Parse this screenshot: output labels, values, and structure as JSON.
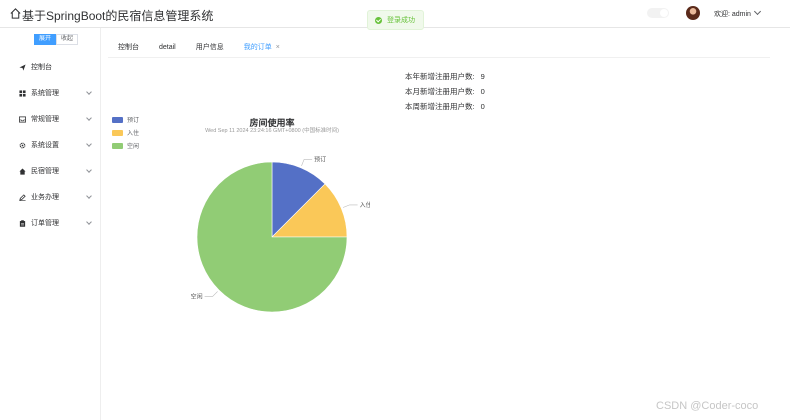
{
  "header": {
    "title": "基于SpringBoot的民宿信息管理系统",
    "toast": "登录成功",
    "welcome": "欢迎: admin"
  },
  "sidebar": {
    "expand_label": "展开",
    "collapse_label": "收起",
    "items": [
      {
        "label": "控制台",
        "icon": "send-icon",
        "has_children": false
      },
      {
        "label": "系统管理",
        "icon": "grid-icon",
        "has_children": true
      },
      {
        "label": "常规管理",
        "icon": "inbox-icon",
        "has_children": true
      },
      {
        "label": "系统设置",
        "icon": "gear-icon",
        "has_children": true
      },
      {
        "label": "民宿管理",
        "icon": "home-icon",
        "has_children": true
      },
      {
        "label": "业务办理",
        "icon": "edit-icon",
        "has_children": true
      },
      {
        "label": "订单管理",
        "icon": "clipboard-icon",
        "has_children": true
      }
    ]
  },
  "tabs": [
    {
      "label": "控制台",
      "active": false
    },
    {
      "label": "detail",
      "active": false
    },
    {
      "label": "用户信息",
      "active": false
    },
    {
      "label": "我的订单",
      "active": true,
      "closable": true
    }
  ],
  "stats": [
    {
      "label": "本年新增注册用户数:",
      "value": "9"
    },
    {
      "label": "本月新增注册用户数:",
      "value": "0"
    },
    {
      "label": "本周新增注册用户数:",
      "value": "0"
    }
  ],
  "chart_data": {
    "type": "pie",
    "title": "房间使用率",
    "subtitle": "Wed Sep 11 2024 23:24:16 GMT+0800 (中国标准时间)",
    "legend_position": "top-left",
    "slices": [
      {
        "name": "预订",
        "value": 1,
        "color": "#5470c6"
      },
      {
        "name": "入住",
        "value": 1,
        "color": "#fac858"
      },
      {
        "name": "空闲",
        "value": 6,
        "color": "#91cc75"
      }
    ]
  },
  "watermark": "CSDN @Coder-coco"
}
